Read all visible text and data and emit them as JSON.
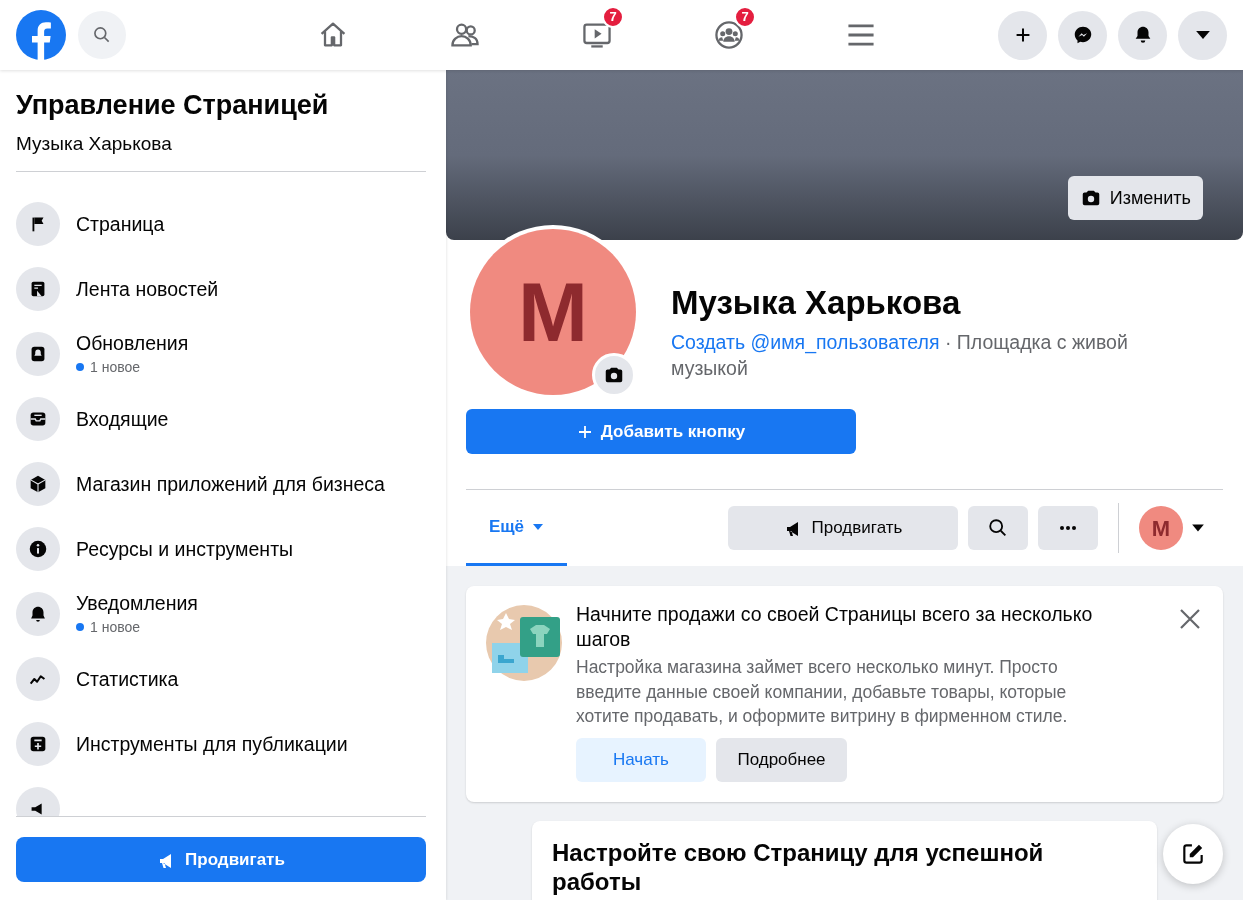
{
  "top_bar": {
    "nav": [
      {
        "kind": "home"
      },
      {
        "kind": "friends"
      },
      {
        "kind": "watch",
        "badge": "7"
      },
      {
        "kind": "groups",
        "badge": "7"
      },
      {
        "kind": "menu"
      }
    ],
    "actions": [
      {
        "kind": "plus"
      },
      {
        "kind": "messenger"
      },
      {
        "kind": "bell"
      },
      {
        "kind": "caret"
      }
    ]
  },
  "sidebar": {
    "title": "Управление Страницей",
    "subtitle": "Музыка Харькова",
    "items": [
      {
        "kind": "flag",
        "label": "Страница"
      },
      {
        "kind": "news",
        "label": "Лента новостей"
      },
      {
        "kind": "updates",
        "label": "Обновления",
        "note": "1 новое"
      },
      {
        "kind": "inbox",
        "label": "Входящие"
      },
      {
        "kind": "box",
        "label": "Магазин приложений для бизнеса"
      },
      {
        "kind": "info",
        "label": "Ресурсы и инструменты"
      },
      {
        "kind": "bell",
        "label": "Уведомления",
        "note": "1 новое"
      },
      {
        "kind": "stats",
        "label": "Статистика"
      },
      {
        "kind": "publish",
        "label": "Инструменты для публикации"
      },
      {
        "kind": "ads"
      }
    ],
    "promote_button": "Продвигать"
  },
  "cover": {
    "edit_button": "Изменить"
  },
  "profile": {
    "avatar_letter": "M",
    "name": "Музыка Харькова",
    "username_link": "Создать @имя_пользователя",
    "category": " · Площадка с живой музыкой",
    "add_button": "Добавить кнопку"
  },
  "tabs": [
    {
      "label": "Ещё",
      "selected": true
    }
  ],
  "tab_actions": {
    "promote": "Продвигать",
    "avatar_letter": "M"
  },
  "shop_card": {
    "title": "Начните продажи со своей Страницы всего за несколько шагов",
    "text": "Настройка магазина займет всего несколько минут. Просто введите данные своей компании, добавьте товары, которые хотите продавать, и оформите витрину в фирменном стиле.",
    "primary_button": "Начать",
    "secondary_button": "Подробнее"
  },
  "setup_card": {
    "title": "Настройте свою Страницу для успешной работы"
  }
}
